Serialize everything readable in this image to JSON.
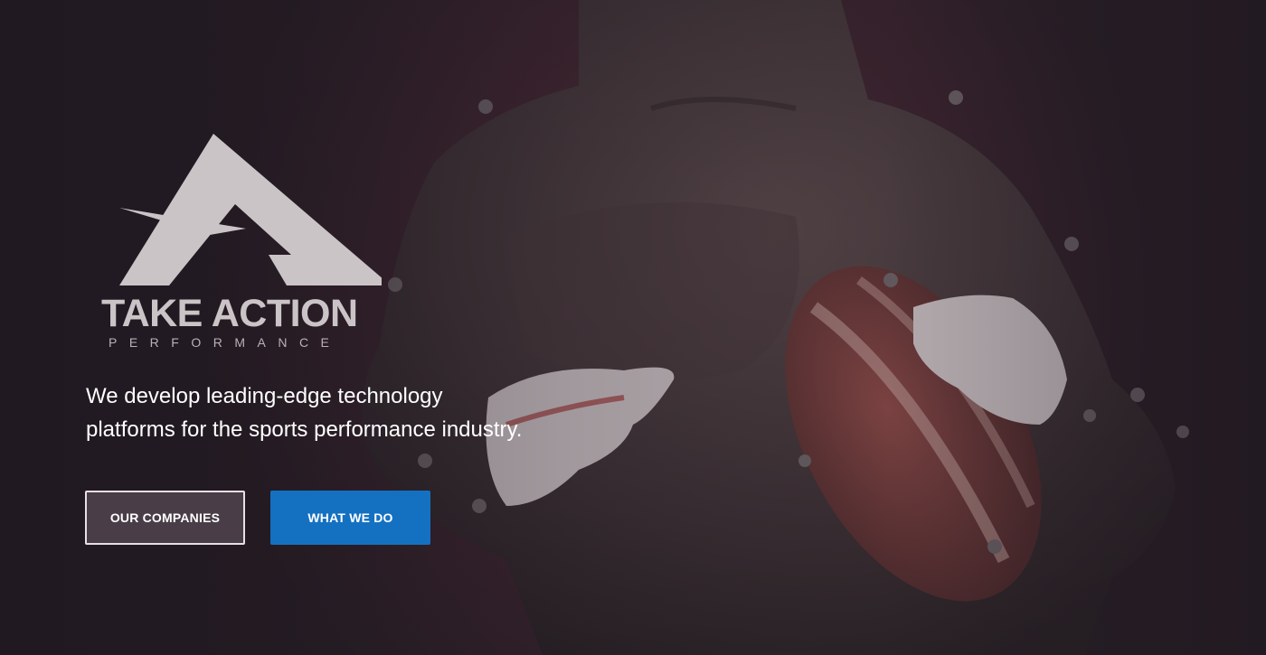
{
  "brand": {
    "name": "TAKE ACTION",
    "sub": "PERFORMANCE"
  },
  "hero": {
    "tagline_line1": "We develop leading-edge technology",
    "tagline_line2": "platforms for the sports performance industry."
  },
  "buttons": {
    "our_companies": "OUR COMPANIES",
    "what_we_do": "WHAT WE DO"
  },
  "colors": {
    "accent": "#1471c2",
    "background": "#3e2530",
    "logo": "#cbc4c7"
  }
}
